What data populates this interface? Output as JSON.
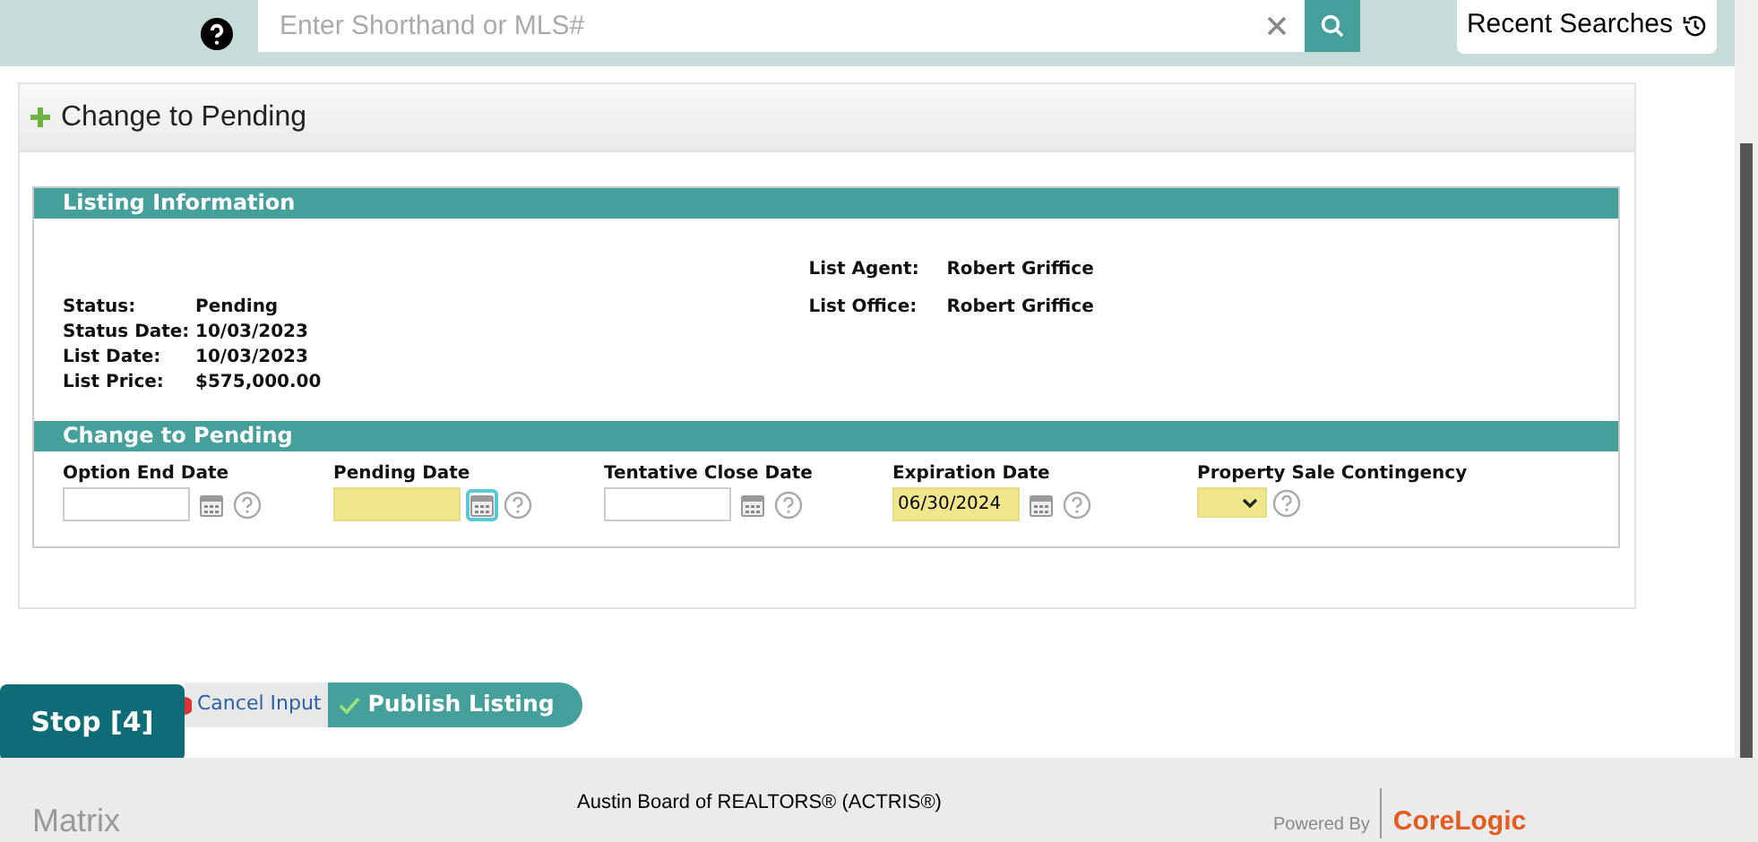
{
  "search": {
    "placeholder": "Enter Shorthand or MLS#"
  },
  "recent_searches": {
    "label": "Recent Searches"
  },
  "panel": {
    "title": "Change to Pending"
  },
  "listing_information": {
    "title": "Listing Information",
    "left": [
      {
        "label": "Status:",
        "value": "Pending"
      },
      {
        "label": "Status Date:",
        "value": "10/03/2023"
      },
      {
        "label": "List Date:",
        "value": "10/03/2023"
      },
      {
        "label": "List Price:",
        "value": "$575,000.00"
      }
    ],
    "right": [
      {
        "label": "List Agent:",
        "value": "Robert Griffice"
      },
      {
        "label": "List Office:",
        "value": "Robert Griffice"
      }
    ]
  },
  "change_section": {
    "title": "Change to Pending",
    "fields": [
      {
        "kind": "date",
        "label": "Option End Date",
        "required": false,
        "focused": false
      },
      {
        "kind": "date",
        "label": "Pending Date",
        "required": true,
        "focused": true
      },
      {
        "kind": "date",
        "label": "Tentative Close Date",
        "required": false,
        "focused": false
      },
      {
        "kind": "date",
        "label": "Expiration Date",
        "value": "06/30/2024",
        "required": true,
        "focused": false
      },
      {
        "kind": "select",
        "label": "Property Sale Contingency",
        "required": true
      }
    ]
  },
  "actions": {
    "cancel": "Cancel Input",
    "publish": "Publish Listing"
  },
  "stop_button": {
    "label": "Stop [4]"
  },
  "footer": {
    "brand": "Matrix",
    "board": "Austin Board of REALTORS® (ACTRIS®)",
    "powered_by": "Powered By",
    "company": "CoreLogic"
  }
}
